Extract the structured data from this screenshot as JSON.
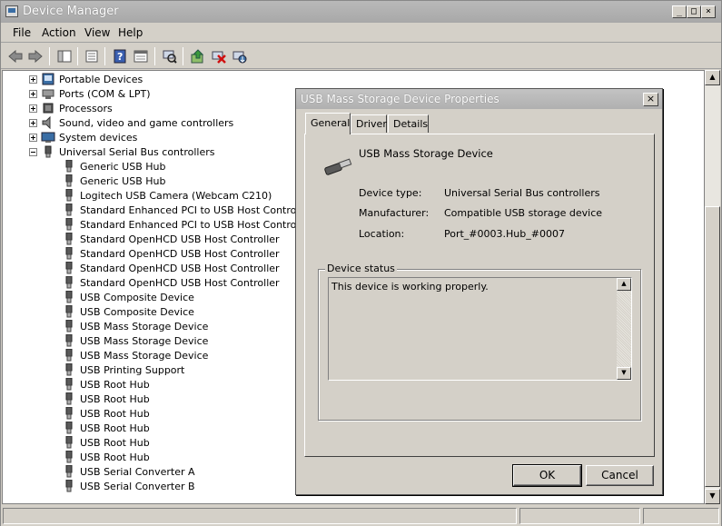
{
  "window": {
    "title": "Device Manager",
    "minimize_label": "_",
    "maximize_label": "□",
    "close_label": "×"
  },
  "menubar": {
    "items": [
      "File",
      "Action",
      "View",
      "Help"
    ]
  },
  "toolbar": {
    "buttons": [
      "back-icon",
      "forward-icon",
      "show-hide-console-tree-icon",
      "properties-sheet-icon",
      "help-icon",
      "export-list-icon",
      "scan-hardware-icon",
      "update-driver-icon",
      "uninstall-icon",
      "enable-device-icon"
    ]
  },
  "tree": {
    "categories": [
      {
        "label": "Portable Devices",
        "icon": "portable-device-icon"
      },
      {
        "label": "Ports (COM & LPT)",
        "icon": "port-icon"
      },
      {
        "label": "Processors",
        "icon": "processor-icon"
      },
      {
        "label": "Sound, video and game controllers",
        "icon": "speaker-icon"
      },
      {
        "label": "System devices",
        "icon": "system-device-icon"
      },
      {
        "label": "Universal Serial Bus controllers",
        "icon": "usb-icon"
      }
    ],
    "usb_children": [
      "Generic USB Hub",
      "Generic USB Hub",
      "Logitech USB Camera (Webcam C210)",
      "Standard Enhanced PCI to USB Host Controller",
      "Standard Enhanced PCI to USB Host Controller",
      "Standard OpenHCD USB Host Controller",
      "Standard OpenHCD USB Host Controller",
      "Standard OpenHCD USB Host Controller",
      "Standard OpenHCD USB Host Controller",
      "USB Composite Device",
      "USB Composite Device",
      "USB Mass Storage Device",
      "USB Mass Storage Device",
      "USB Mass Storage Device",
      "USB Printing Support",
      "USB Root Hub",
      "USB Root Hub",
      "USB Root Hub",
      "USB Root Hub",
      "USB Root Hub",
      "USB Root Hub",
      "USB Serial Converter A",
      "USB Serial Converter B"
    ]
  },
  "dialog": {
    "title": "USB Mass Storage Device Properties",
    "close_label": "×",
    "tabs": [
      "General",
      "Driver",
      "Details"
    ],
    "active_tab": "General",
    "device_name": "USB Mass Storage Device",
    "device_type_label": "Device type:",
    "device_type_value": "Universal Serial Bus controllers",
    "manufacturer_label": "Manufacturer:",
    "manufacturer_value": "Compatible USB storage device",
    "location_label": "Location:",
    "location_value": "Port_#0003.Hub_#0007",
    "status_group_label": "Device status",
    "status_text": "This device is working properly.",
    "ok_label": "OK",
    "cancel_label": "Cancel"
  }
}
